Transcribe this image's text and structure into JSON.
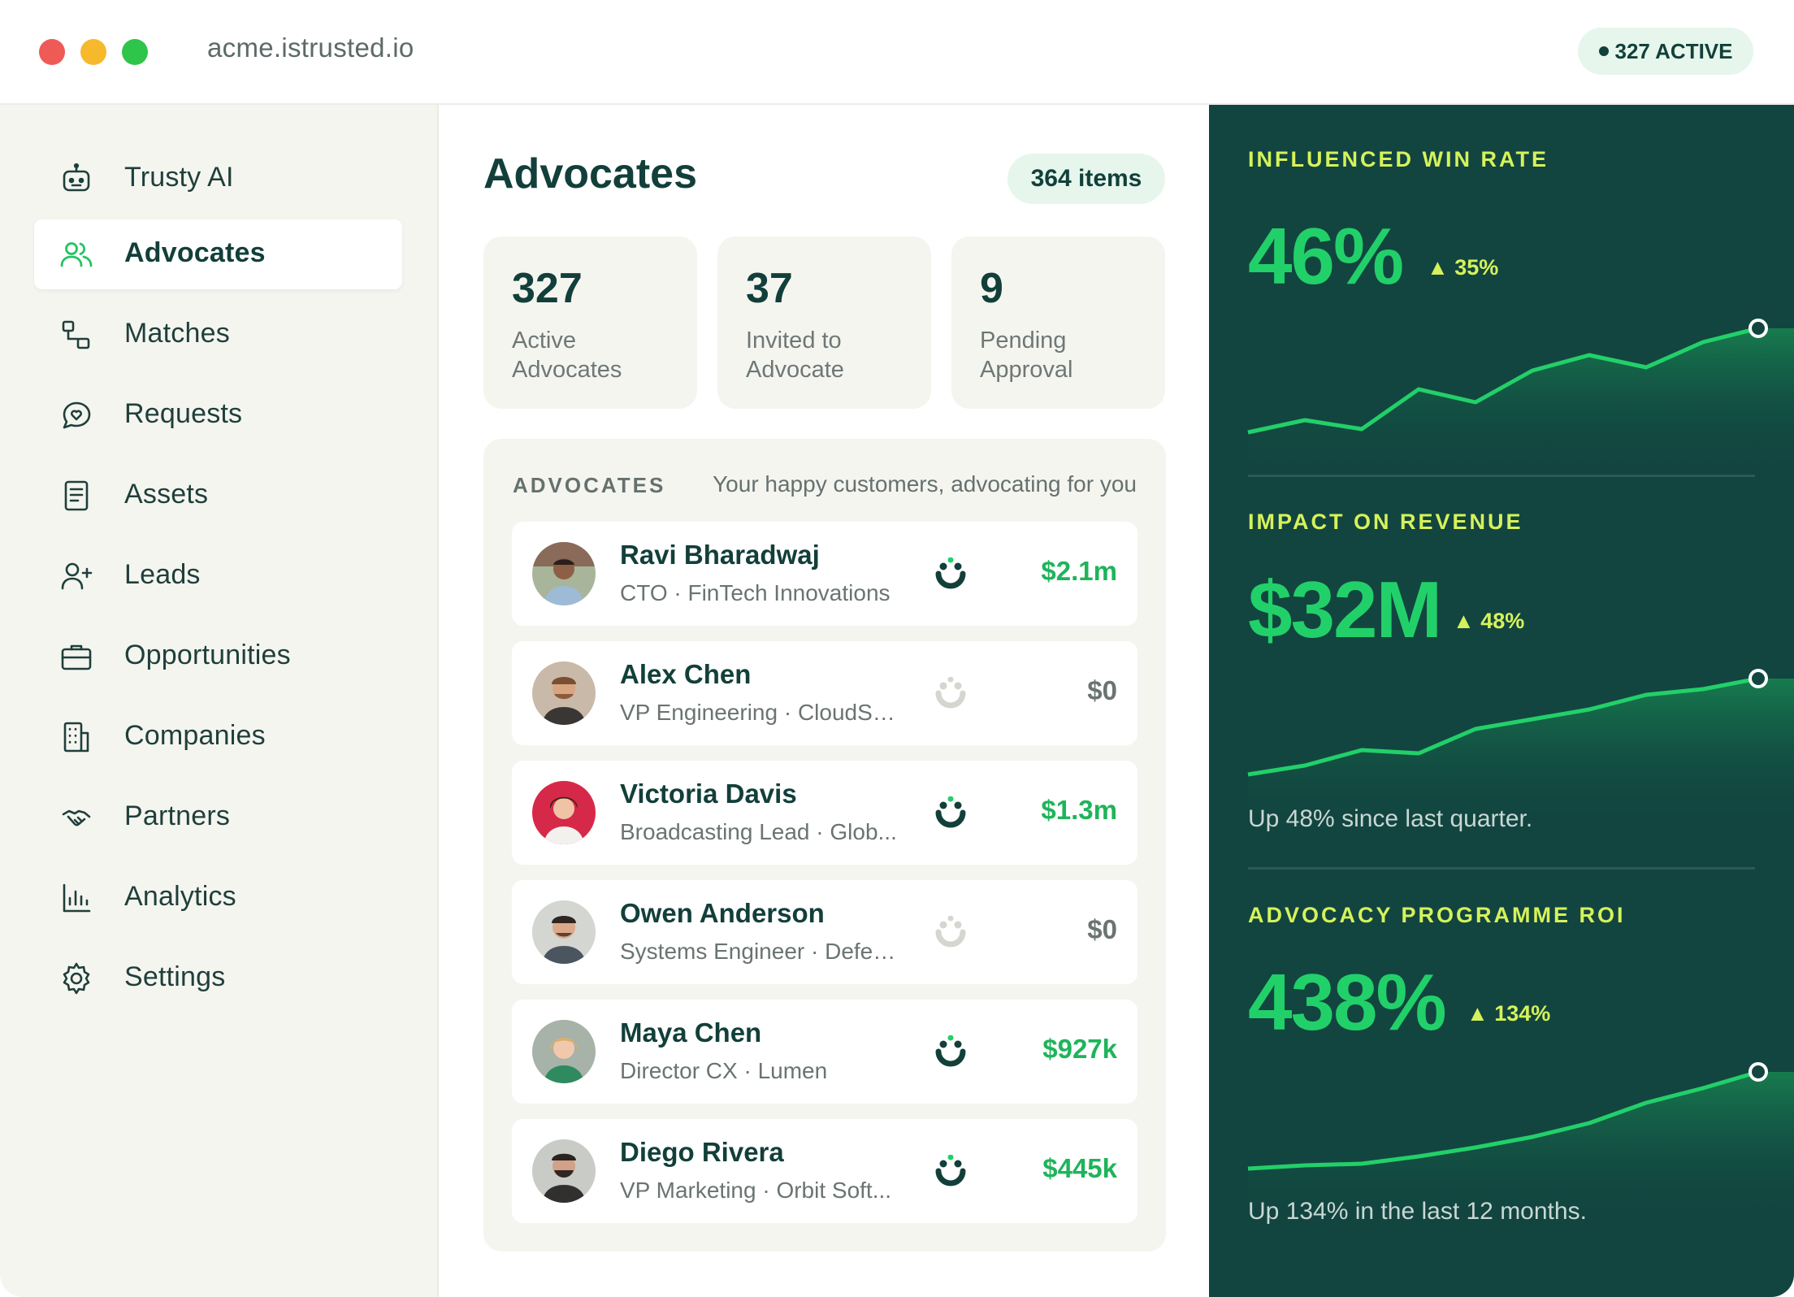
{
  "window": {
    "url": "acme.istrusted.io",
    "active_badge": "327 ACTIVE"
  },
  "sidebar": {
    "items": [
      {
        "label": "Trusty AI",
        "icon": "robot-icon"
      },
      {
        "label": "Advocates",
        "icon": "users-icon",
        "active": true
      },
      {
        "label": "Matches",
        "icon": "match-icon"
      },
      {
        "label": "Requests",
        "icon": "chat-heart-icon"
      },
      {
        "label": "Assets",
        "icon": "document-icon"
      },
      {
        "label": "Leads",
        "icon": "user-plus-icon"
      },
      {
        "label": "Opportunities",
        "icon": "briefcase-icon"
      },
      {
        "label": "Companies",
        "icon": "building-icon"
      },
      {
        "label": "Partners",
        "icon": "handshake-icon"
      },
      {
        "label": "Analytics",
        "icon": "bar-chart-icon"
      },
      {
        "label": "Settings",
        "icon": "gear-icon"
      }
    ]
  },
  "main": {
    "title": "Advocates",
    "items_count": "364 items",
    "stats": [
      {
        "value": "327",
        "label": "Active Advocates"
      },
      {
        "value": "37",
        "label": "Invited to Advocate"
      },
      {
        "value": "9",
        "label": "Pending Approval"
      }
    ],
    "list": {
      "heading": "ADVOCATES",
      "subtitle": "Your happy customers, advocating for you",
      "rows": [
        {
          "name": "Ravi Bharadwaj",
          "role": "CTO · FinTech Innovations",
          "value": "$2.1m",
          "happy": true
        },
        {
          "name": "Alex Chen",
          "role": "VP Engineering · CloudSc...",
          "value": "$0",
          "happy": false
        },
        {
          "name": "Victoria Davis",
          "role": "Broadcasting Lead · Glob...",
          "value": "$1.3m",
          "happy": true
        },
        {
          "name": "Owen Anderson",
          "role": "Systems Engineer · Defen...",
          "value": "$0",
          "happy": false
        },
        {
          "name": "Maya Chen",
          "role": "Director CX · Lumen",
          "value": "$927k",
          "happy": true
        },
        {
          "name": "Diego Rivera",
          "role": "VP Marketing · Orbit Soft...",
          "value": "$445k",
          "happy": true
        }
      ]
    }
  },
  "kpis": [
    {
      "label": "INFLUENCED WIN RATE",
      "value": "46%",
      "delta": "35%",
      "note": ""
    },
    {
      "label": "IMPACT ON REVENUE",
      "value": "$32M",
      "delta": "48%",
      "note": "Up 48% since last quarter."
    },
    {
      "label": "ADVOCACY PROGRAMME ROI",
      "value": "438%",
      "delta": "134%",
      "note": "Up 134% in the last 12 months."
    }
  ],
  "colors": {
    "accent_green": "#22d069",
    "value_green": "#1fb45b",
    "muted_value": "#6a7472",
    "panel_dark": "#124540",
    "lime": "#d6f25a"
  }
}
